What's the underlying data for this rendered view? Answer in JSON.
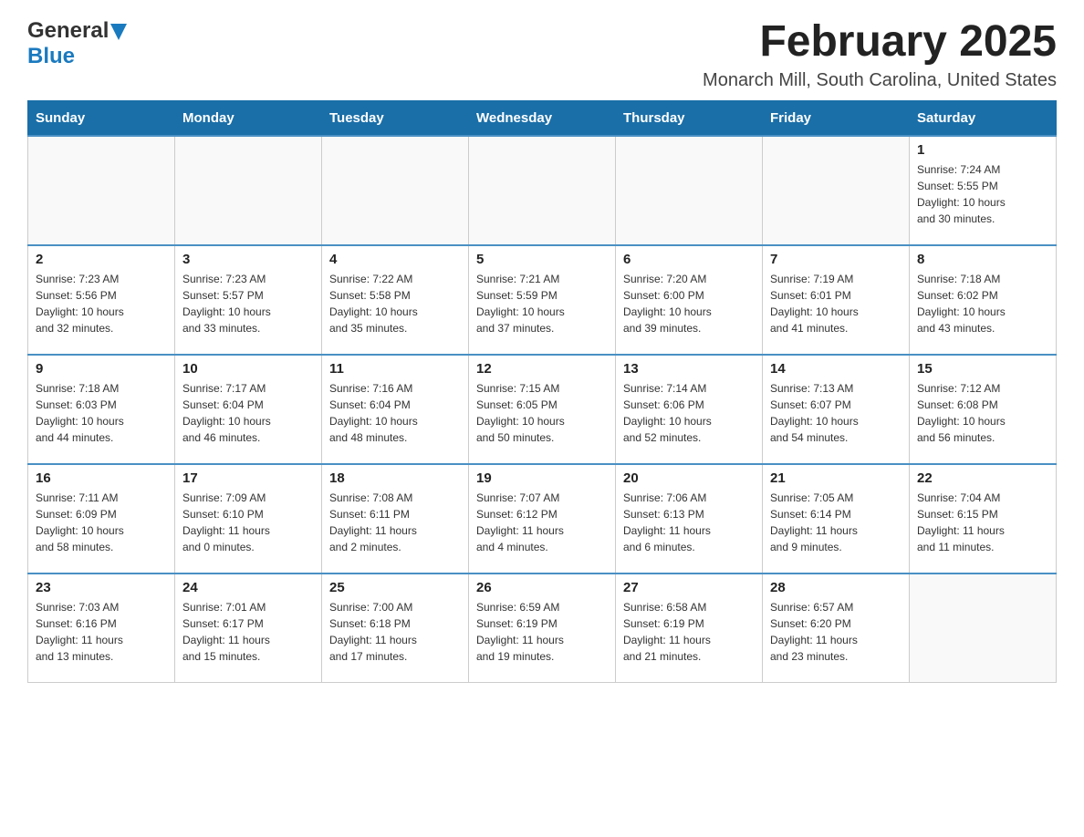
{
  "logo": {
    "general": "General",
    "blue": "Blue"
  },
  "header": {
    "title": "February 2025",
    "location": "Monarch Mill, South Carolina, United States"
  },
  "weekdays": [
    "Sunday",
    "Monday",
    "Tuesday",
    "Wednesday",
    "Thursday",
    "Friday",
    "Saturday"
  ],
  "weeks": [
    {
      "days": [
        {
          "number": "",
          "info": ""
        },
        {
          "number": "",
          "info": ""
        },
        {
          "number": "",
          "info": ""
        },
        {
          "number": "",
          "info": ""
        },
        {
          "number": "",
          "info": ""
        },
        {
          "number": "",
          "info": ""
        },
        {
          "number": "1",
          "info": "Sunrise: 7:24 AM\nSunset: 5:55 PM\nDaylight: 10 hours\nand 30 minutes."
        }
      ]
    },
    {
      "days": [
        {
          "number": "2",
          "info": "Sunrise: 7:23 AM\nSunset: 5:56 PM\nDaylight: 10 hours\nand 32 minutes."
        },
        {
          "number": "3",
          "info": "Sunrise: 7:23 AM\nSunset: 5:57 PM\nDaylight: 10 hours\nand 33 minutes."
        },
        {
          "number": "4",
          "info": "Sunrise: 7:22 AM\nSunset: 5:58 PM\nDaylight: 10 hours\nand 35 minutes."
        },
        {
          "number": "5",
          "info": "Sunrise: 7:21 AM\nSunset: 5:59 PM\nDaylight: 10 hours\nand 37 minutes."
        },
        {
          "number": "6",
          "info": "Sunrise: 7:20 AM\nSunset: 6:00 PM\nDaylight: 10 hours\nand 39 minutes."
        },
        {
          "number": "7",
          "info": "Sunrise: 7:19 AM\nSunset: 6:01 PM\nDaylight: 10 hours\nand 41 minutes."
        },
        {
          "number": "8",
          "info": "Sunrise: 7:18 AM\nSunset: 6:02 PM\nDaylight: 10 hours\nand 43 minutes."
        }
      ]
    },
    {
      "days": [
        {
          "number": "9",
          "info": "Sunrise: 7:18 AM\nSunset: 6:03 PM\nDaylight: 10 hours\nand 44 minutes."
        },
        {
          "number": "10",
          "info": "Sunrise: 7:17 AM\nSunset: 6:04 PM\nDaylight: 10 hours\nand 46 minutes."
        },
        {
          "number": "11",
          "info": "Sunrise: 7:16 AM\nSunset: 6:04 PM\nDaylight: 10 hours\nand 48 minutes."
        },
        {
          "number": "12",
          "info": "Sunrise: 7:15 AM\nSunset: 6:05 PM\nDaylight: 10 hours\nand 50 minutes."
        },
        {
          "number": "13",
          "info": "Sunrise: 7:14 AM\nSunset: 6:06 PM\nDaylight: 10 hours\nand 52 minutes."
        },
        {
          "number": "14",
          "info": "Sunrise: 7:13 AM\nSunset: 6:07 PM\nDaylight: 10 hours\nand 54 minutes."
        },
        {
          "number": "15",
          "info": "Sunrise: 7:12 AM\nSunset: 6:08 PM\nDaylight: 10 hours\nand 56 minutes."
        }
      ]
    },
    {
      "days": [
        {
          "number": "16",
          "info": "Sunrise: 7:11 AM\nSunset: 6:09 PM\nDaylight: 10 hours\nand 58 minutes."
        },
        {
          "number": "17",
          "info": "Sunrise: 7:09 AM\nSunset: 6:10 PM\nDaylight: 11 hours\nand 0 minutes."
        },
        {
          "number": "18",
          "info": "Sunrise: 7:08 AM\nSunset: 6:11 PM\nDaylight: 11 hours\nand 2 minutes."
        },
        {
          "number": "19",
          "info": "Sunrise: 7:07 AM\nSunset: 6:12 PM\nDaylight: 11 hours\nand 4 minutes."
        },
        {
          "number": "20",
          "info": "Sunrise: 7:06 AM\nSunset: 6:13 PM\nDaylight: 11 hours\nand 6 minutes."
        },
        {
          "number": "21",
          "info": "Sunrise: 7:05 AM\nSunset: 6:14 PM\nDaylight: 11 hours\nand 9 minutes."
        },
        {
          "number": "22",
          "info": "Sunrise: 7:04 AM\nSunset: 6:15 PM\nDaylight: 11 hours\nand 11 minutes."
        }
      ]
    },
    {
      "days": [
        {
          "number": "23",
          "info": "Sunrise: 7:03 AM\nSunset: 6:16 PM\nDaylight: 11 hours\nand 13 minutes."
        },
        {
          "number": "24",
          "info": "Sunrise: 7:01 AM\nSunset: 6:17 PM\nDaylight: 11 hours\nand 15 minutes."
        },
        {
          "number": "25",
          "info": "Sunrise: 7:00 AM\nSunset: 6:18 PM\nDaylight: 11 hours\nand 17 minutes."
        },
        {
          "number": "26",
          "info": "Sunrise: 6:59 AM\nSunset: 6:19 PM\nDaylight: 11 hours\nand 19 minutes."
        },
        {
          "number": "27",
          "info": "Sunrise: 6:58 AM\nSunset: 6:19 PM\nDaylight: 11 hours\nand 21 minutes."
        },
        {
          "number": "28",
          "info": "Sunrise: 6:57 AM\nSunset: 6:20 PM\nDaylight: 11 hours\nand 23 minutes."
        },
        {
          "number": "",
          "info": ""
        }
      ]
    }
  ]
}
